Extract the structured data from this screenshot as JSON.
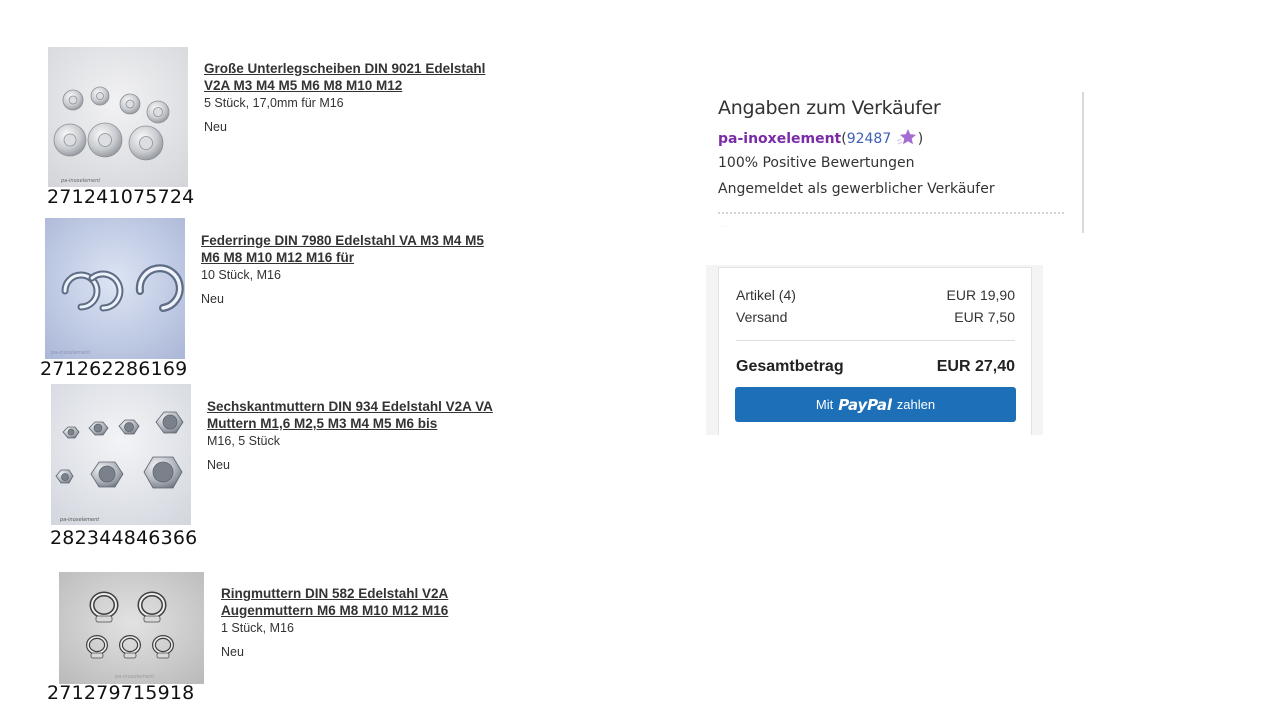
{
  "items": [
    {
      "id": "271241075724",
      "title": "Große Unterlegscheiben DIN 9021 Edelstahl V2A M3 M4 M5 M6 M8 M10 M12",
      "variant": "5 Stück, 17,0mm für M16",
      "condition": "Neu",
      "image_icon": "washers-photo",
      "watermark": "pa-inoxelement"
    },
    {
      "id": "271262286169",
      "title": "Federringe DIN 7980 Edelstahl VA M3 M4 M5 M6 M8 M10 M12 M16 für",
      "variant": "10 Stück, M16",
      "condition": "Neu",
      "image_icon": "spring-washers-photo",
      "watermark": "pa-inoxelement"
    },
    {
      "id": "282344846366",
      "title": "Sechskantmuttern DIN 934 Edelstahl V2A VA Muttern M1,6 M2,5 M3 M4 M5 M6 bis",
      "variant": "M16, 5 Stück",
      "condition": "Neu",
      "image_icon": "hex-nuts-photo",
      "watermark": "pa-inoxelement"
    },
    {
      "id": "271279715918",
      "title": "Ringmuttern DIN 582 Edelstahl V2A Augenmuttern M6 M8 M10 M12 M16",
      "variant": "1 Stück, M16",
      "condition": "Neu",
      "image_icon": "eye-nuts-photo",
      "watermark": "pa-inoxelement"
    }
  ],
  "seller": {
    "heading": "Angaben zum Verkäufer",
    "name": "pa-inoxelement",
    "paren_open": "(",
    "score": "92487",
    "paren_close": ")",
    "star_icon": "purple-star-icon",
    "star_color": "#a46bd1",
    "positive": "100% Positive Bewertungen",
    "registered": "Angemeldet als gewerblicher Verkäufer"
  },
  "summary": {
    "items_label": "Artikel (4)",
    "items_value": "EUR 19,90",
    "shipping_label": "Versand",
    "shipping_value": "EUR 7,50",
    "total_label": "Gesamtbetrag",
    "total_value": "EUR 27,40",
    "paypal_prefix": "Mit",
    "paypal_brand": "PayPal",
    "paypal_suffix": "zahlen",
    "paypal_color": "#1d6fb8"
  }
}
